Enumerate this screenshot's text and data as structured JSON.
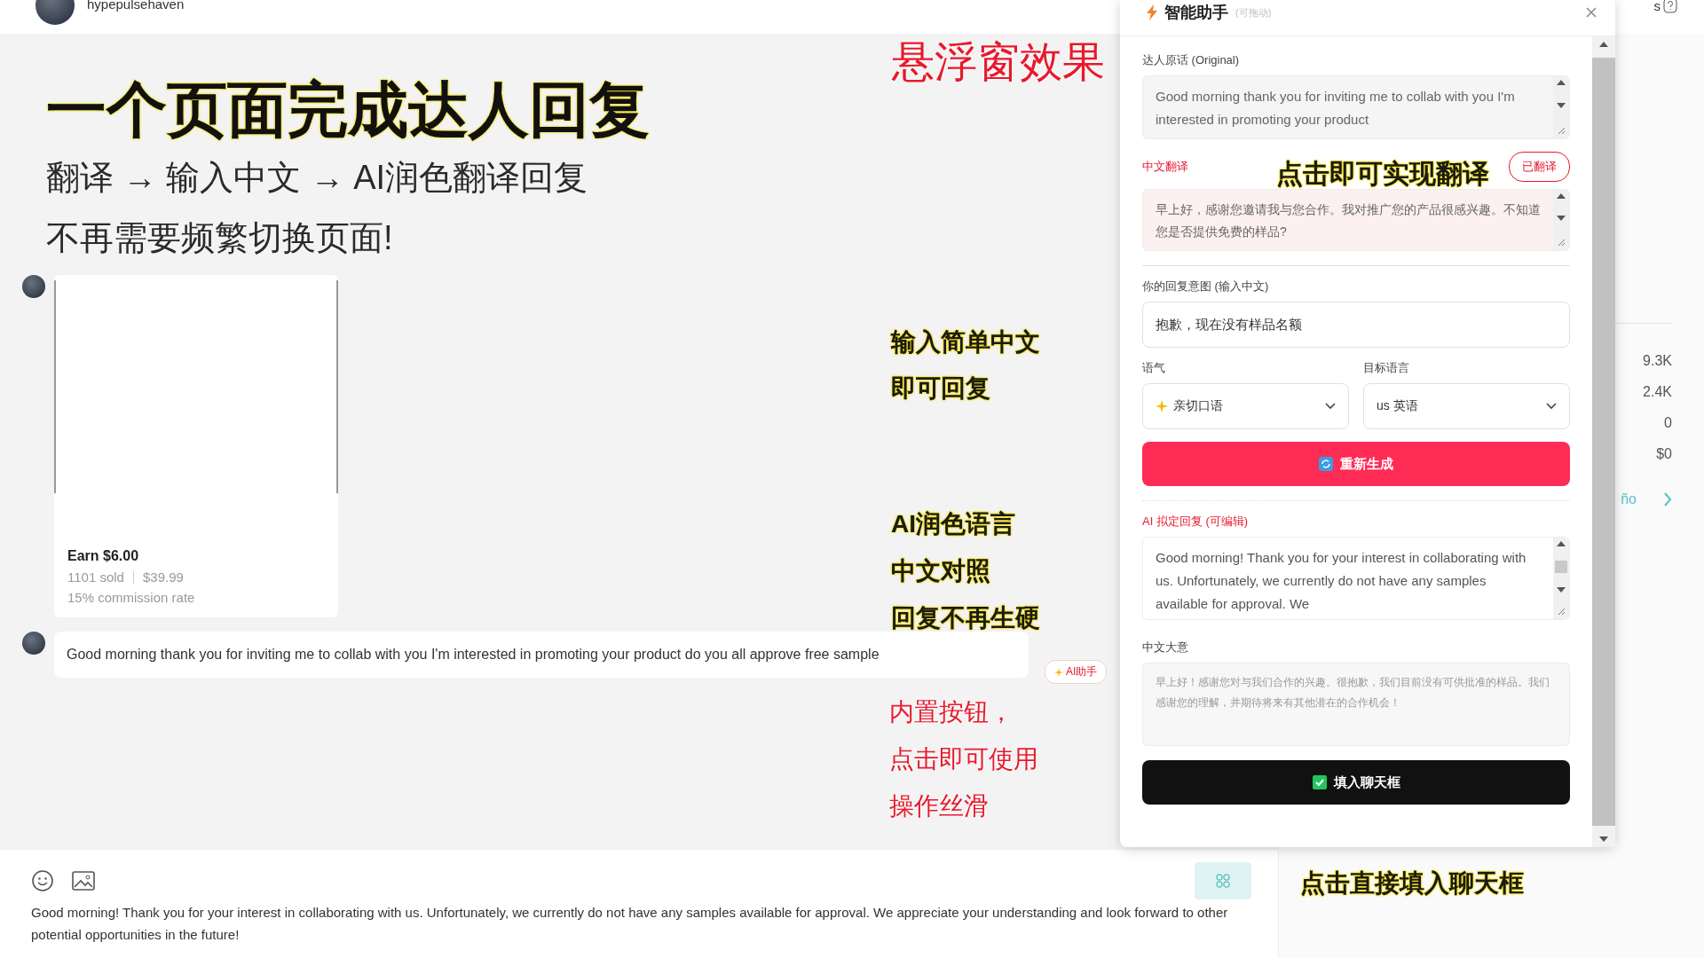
{
  "conversation": {
    "username": "hypepulsehaven",
    "headline": {
      "title": "一个页面完成达人回复",
      "lines": [
        "翻译 → 输入中文 → AI润色翻译回复",
        "不再需要频繁切换页面!"
      ]
    },
    "messages": [
      {
        "kind": "product",
        "earn": "Earn $6.00",
        "sold": "1101 sold",
        "price": "$39.99",
        "commission": "15% commission rate"
      },
      {
        "kind": "text",
        "text": "Good morning thank you for inviting me to collab with you I'm interested in promoting your product do you all approve free sample",
        "action": "AI助手"
      }
    ]
  },
  "composer": {
    "value": "Good morning! Thank you for your interest in collaborating with us. Unfortunately, we currently do not have any samples available for approval. We appreciate your understanding and look forward to other potential opportunities in the future!"
  },
  "side_panel": {
    "header": "s",
    "stats": [
      "9.3K",
      "2.4K",
      "0",
      "$0"
    ],
    "link": "ño"
  },
  "assistant": {
    "title": "智能助手",
    "hint": "(可拖动)",
    "original_label": "达人原话 (Original)",
    "original_text": "Good morning thank you for inviting me to collab with you I'm interested in promoting your product",
    "translation_label": "中文翻译",
    "translated_badge": "已翻译",
    "translation_text": "早上好，感谢您邀请我与您合作。我对推广您的产品很感兴趣。不知道您是否提供免费的样品?",
    "intent_label": "你的回复意图 (输入中文)",
    "intent_value": "抱歉，现在没有样品名额",
    "tone_label": "语气",
    "tone_value": "亲切口语",
    "language_label": "目标语言",
    "language_value": "us 英语",
    "regenerate": "重新生成",
    "reply_label": "AI 拟定回复 (可编辑)",
    "reply_text": "Good morning! Thank you for your interest in collaborating with us. Unfortunately, we currently do not have any samples available for approval. We",
    "summary_label": "中文大意",
    "summary_text": "早上好！感谢您对与我们合作的兴趣。很抱歉，我们目前没有可供批准的样品。我们感谢您的理解，并期待将来有其他潜在的合作机会！",
    "fill": "填入聊天框"
  },
  "annotations": [
    {
      "kind": "red",
      "lines": [
        "悬浮窗效果"
      ]
    },
    {
      "kind": "yellow",
      "lines": [
        "点击即可实现翻译"
      ]
    },
    {
      "kind": "yellow",
      "lines": [
        "输入简单中文",
        "即可回复"
      ]
    },
    {
      "kind": "yellow",
      "lines": [
        "AI润色语言",
        "中文对照",
        "回复不再生硬"
      ]
    },
    {
      "kind": "red",
      "lines": [
        "内置按钮，",
        "点击即可使用",
        "操作丝滑"
      ]
    },
    {
      "kind": "yellow",
      "lines": [
        "点击直接填入聊天框"
      ]
    }
  ]
}
